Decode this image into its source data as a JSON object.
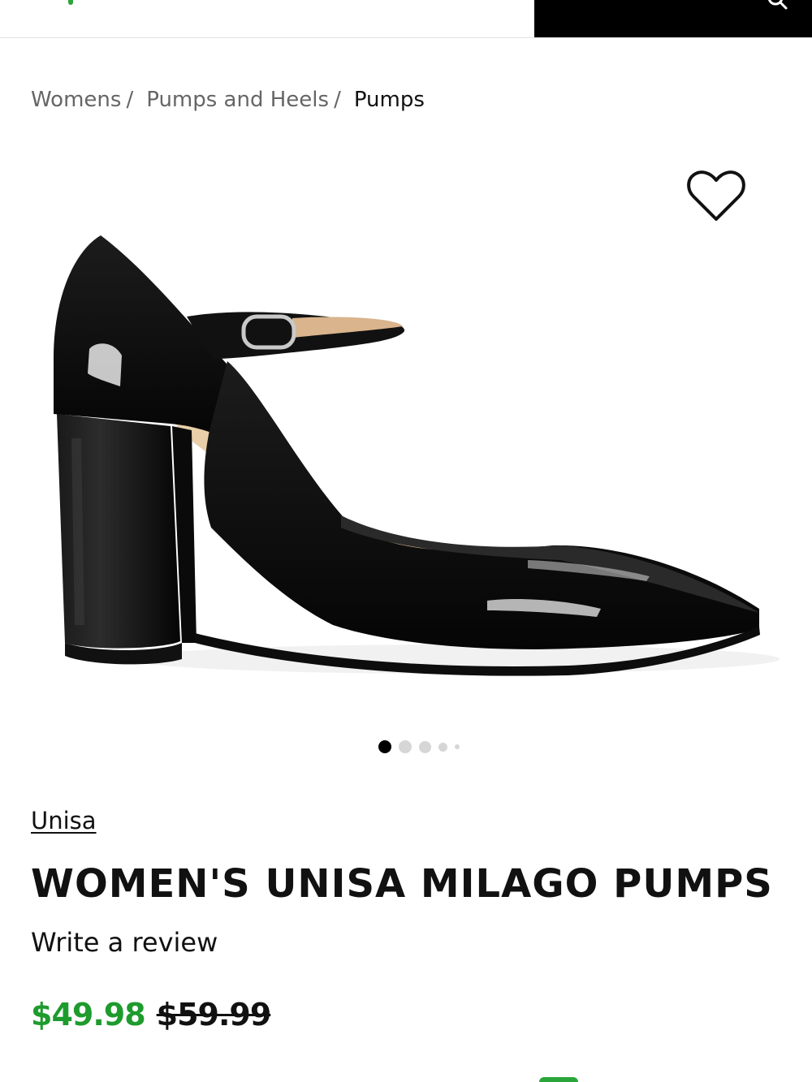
{
  "header": {
    "accent_color": "#2aa53a",
    "search_icon": "search-icon"
  },
  "breadcrumb": {
    "items": [
      "Womens",
      "Pumps and Heels",
      "Pumps"
    ],
    "separator": "/"
  },
  "gallery": {
    "image_subject": "black patent block-heel pump with ankle strap",
    "wishlist_icon": "heart-icon",
    "total_dots": 5,
    "active_dot": 1
  },
  "product": {
    "brand": "Unisa",
    "title": "WOMEN'S UNISA MILAGO PUMPS",
    "review_link": "Write a review",
    "sale_price": "$49.98",
    "original_price": "$59.99",
    "sale_color": "#1e9b2d"
  }
}
